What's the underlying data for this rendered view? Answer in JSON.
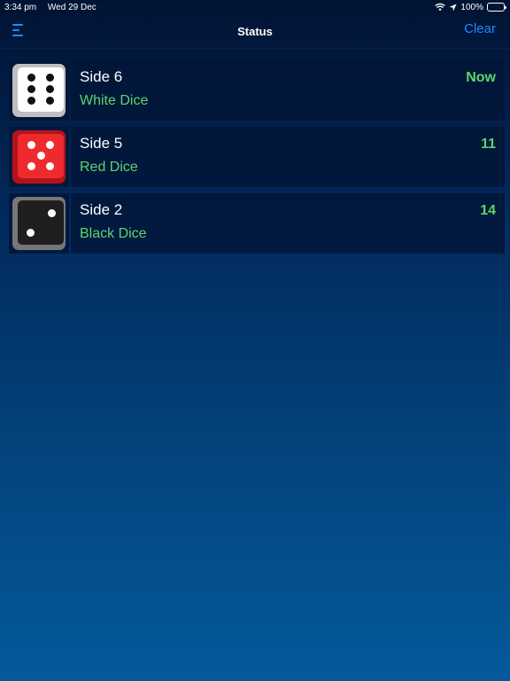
{
  "status_bar": {
    "time": "3:34 pm",
    "date": "Wed 29 Dec",
    "battery": "100%",
    "icons": [
      "wifi-icon",
      "location-arrow-icon",
      "battery-icon"
    ]
  },
  "nav": {
    "title": "Status",
    "clear_label": "Clear",
    "menu_icon": "menu-icon"
  },
  "colors": {
    "accent": "#1e8cff",
    "green": "#5fd36b"
  },
  "items": [
    {
      "title": "Side 6",
      "subtitle": "White Dice",
      "time": "Now",
      "die_color": "white",
      "pips": 6
    },
    {
      "title": "Side 5",
      "subtitle": "Red Dice",
      "time": "11",
      "die_color": "red",
      "pips": 5
    },
    {
      "title": "Side 2",
      "subtitle": "Black Dice",
      "time": "14",
      "die_color": "black",
      "pips": 2
    }
  ]
}
